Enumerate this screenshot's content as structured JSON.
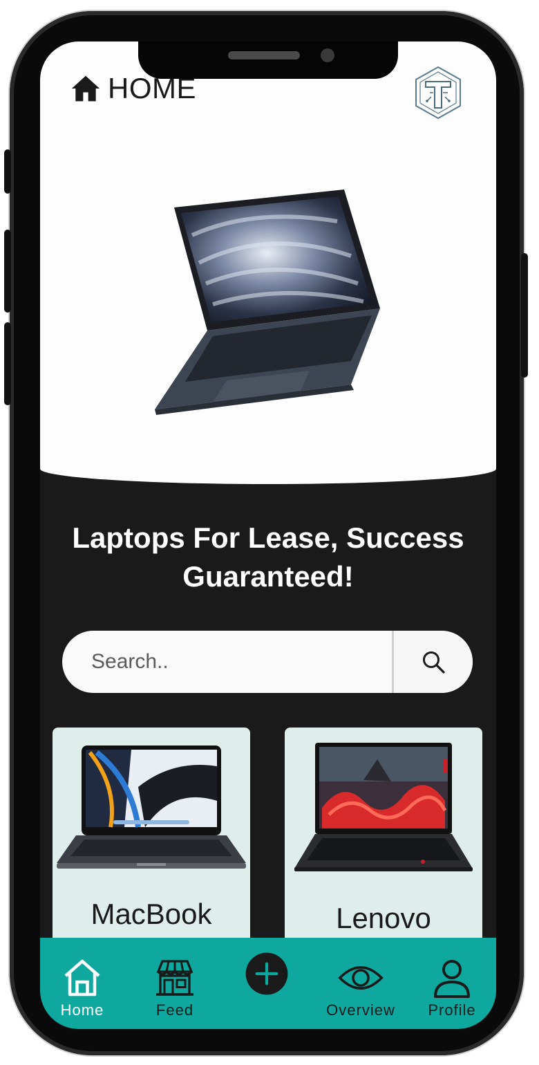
{
  "header": {
    "title": "HOME",
    "icon": "home-icon"
  },
  "brand": {
    "logo": "circuit-t-logo"
  },
  "hero": {
    "image": "macbook-air-laptop"
  },
  "tagline": "Laptops For Lease, Success Guaranteed!",
  "search": {
    "placeholder": "Search..",
    "icon": "search-icon"
  },
  "products": [
    {
      "name": "MacBook",
      "image": "macbook-pro-laptop"
    },
    {
      "name": "Lenovo",
      "image": "lenovo-thinkpad-laptop"
    }
  ],
  "bottom_nav": {
    "items": [
      {
        "label": "Home",
        "icon": "home-outline-icon",
        "active": true
      },
      {
        "label": "Feed",
        "icon": "storefront-icon"
      },
      {
        "label": "",
        "icon": "add-circle-icon"
      },
      {
        "label": "Overview",
        "icon": "eye-icon"
      },
      {
        "label": "Profile",
        "icon": "user-icon"
      }
    ]
  },
  "colors": {
    "accent": "#0fa89e",
    "dark": "#1a1a1a",
    "card": "#dfeeea"
  }
}
